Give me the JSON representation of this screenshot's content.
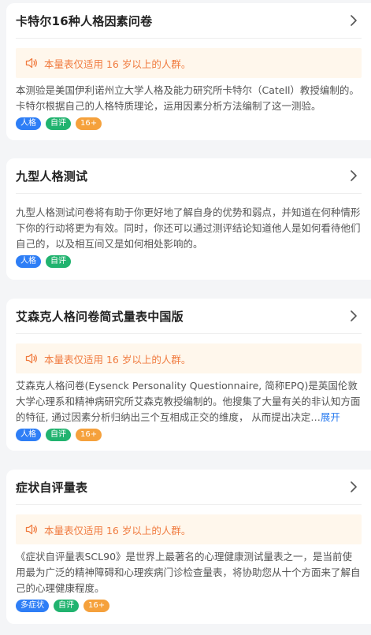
{
  "colors": {
    "tag_blue": "#2e7ef6",
    "tag_green": "#21b36f",
    "tag_orange": "#f5a13c",
    "notice_text": "#f07b3f",
    "notice_bg": "#fff7ec",
    "link": "#2f7ff0"
  },
  "cards": [
    {
      "title": "卡特尔16种人格因素问卷",
      "notice": "本量表仅适用 16 岁以上的人群。",
      "description": "本测验是美国伊利诺州立大学人格及能力研究所卡特尔（Catell）教授编制的。卡特尔根据自己的人格特质理论，运用因素分析方法编制了这一测验。",
      "tags": [
        "人格",
        "自评",
        "16+"
      ]
    },
    {
      "title": "九型人格测试",
      "description": "九型人格测试问卷将有助于你更好地了解自身的优势和弱点，并知道在何种情形下你的行动将更为有效。同时，你还可以通过测评结论知道他人是如何看待他们自己的，以及相互间又是如何相处影响的。",
      "tags": [
        "人格",
        "自评"
      ]
    },
    {
      "title": "艾森克人格问卷简式量表中国版",
      "notice": "本量表仅适用 16 岁以上的人群。",
      "description": "艾森克人格问卷(Eysenck Personality Questionnaire, 简称EPQ)是英国伦敦大学心理系和精神病研究所艾森克教授编制的。他搜集了大量有关的非认知方面的特征, 通过因素分析归纳出三个互相成正交的维度， 从而提出决定…",
      "expand_label": "展开",
      "tags": [
        "人格",
        "自评",
        "16+"
      ]
    },
    {
      "title": "症状自评量表",
      "notice": "本量表仅适用 16 岁以上的人群。",
      "description": "《症状自评量表SCL90》是世界上最著名的心理健康测试量表之一，是当前使用最为广泛的精神障碍和心理疾病门诊检查量表，将协助您从十个方面来了解自己的心理健康程度。",
      "tags": [
        "多症状",
        "自评",
        "16+"
      ]
    }
  ],
  "icons": {
    "chevron": "chevron-right-icon",
    "speaker": "speaker-icon"
  }
}
